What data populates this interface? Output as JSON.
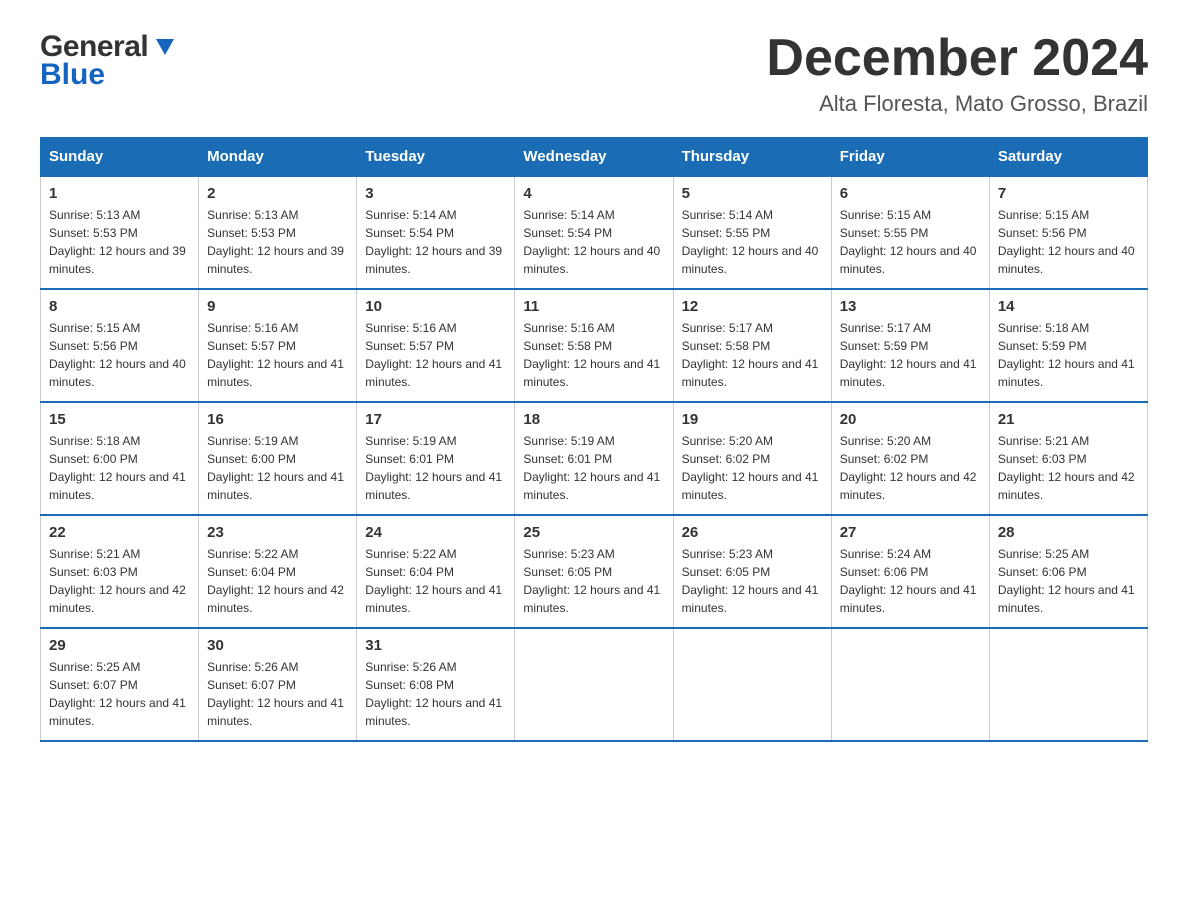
{
  "header": {
    "logo_general": "General",
    "logo_blue": "Blue",
    "title": "December 2024",
    "location": "Alta Floresta, Mato Grosso, Brazil"
  },
  "calendar": {
    "days_of_week": [
      "Sunday",
      "Monday",
      "Tuesday",
      "Wednesday",
      "Thursday",
      "Friday",
      "Saturday"
    ],
    "weeks": [
      [
        {
          "day": "1",
          "sunrise": "5:13 AM",
          "sunset": "5:53 PM",
          "daylight": "12 hours and 39 minutes."
        },
        {
          "day": "2",
          "sunrise": "5:13 AM",
          "sunset": "5:53 PM",
          "daylight": "12 hours and 39 minutes."
        },
        {
          "day": "3",
          "sunrise": "5:14 AM",
          "sunset": "5:54 PM",
          "daylight": "12 hours and 39 minutes."
        },
        {
          "day": "4",
          "sunrise": "5:14 AM",
          "sunset": "5:54 PM",
          "daylight": "12 hours and 40 minutes."
        },
        {
          "day": "5",
          "sunrise": "5:14 AM",
          "sunset": "5:55 PM",
          "daylight": "12 hours and 40 minutes."
        },
        {
          "day": "6",
          "sunrise": "5:15 AM",
          "sunset": "5:55 PM",
          "daylight": "12 hours and 40 minutes."
        },
        {
          "day": "7",
          "sunrise": "5:15 AM",
          "sunset": "5:56 PM",
          "daylight": "12 hours and 40 minutes."
        }
      ],
      [
        {
          "day": "8",
          "sunrise": "5:15 AM",
          "sunset": "5:56 PM",
          "daylight": "12 hours and 40 minutes."
        },
        {
          "day": "9",
          "sunrise": "5:16 AM",
          "sunset": "5:57 PM",
          "daylight": "12 hours and 41 minutes."
        },
        {
          "day": "10",
          "sunrise": "5:16 AM",
          "sunset": "5:57 PM",
          "daylight": "12 hours and 41 minutes."
        },
        {
          "day": "11",
          "sunrise": "5:16 AM",
          "sunset": "5:58 PM",
          "daylight": "12 hours and 41 minutes."
        },
        {
          "day": "12",
          "sunrise": "5:17 AM",
          "sunset": "5:58 PM",
          "daylight": "12 hours and 41 minutes."
        },
        {
          "day": "13",
          "sunrise": "5:17 AM",
          "sunset": "5:59 PM",
          "daylight": "12 hours and 41 minutes."
        },
        {
          "day": "14",
          "sunrise": "5:18 AM",
          "sunset": "5:59 PM",
          "daylight": "12 hours and 41 minutes."
        }
      ],
      [
        {
          "day": "15",
          "sunrise": "5:18 AM",
          "sunset": "6:00 PM",
          "daylight": "12 hours and 41 minutes."
        },
        {
          "day": "16",
          "sunrise": "5:19 AM",
          "sunset": "6:00 PM",
          "daylight": "12 hours and 41 minutes."
        },
        {
          "day": "17",
          "sunrise": "5:19 AM",
          "sunset": "6:01 PM",
          "daylight": "12 hours and 41 minutes."
        },
        {
          "day": "18",
          "sunrise": "5:19 AM",
          "sunset": "6:01 PM",
          "daylight": "12 hours and 41 minutes."
        },
        {
          "day": "19",
          "sunrise": "5:20 AM",
          "sunset": "6:02 PM",
          "daylight": "12 hours and 41 minutes."
        },
        {
          "day": "20",
          "sunrise": "5:20 AM",
          "sunset": "6:02 PM",
          "daylight": "12 hours and 42 minutes."
        },
        {
          "day": "21",
          "sunrise": "5:21 AM",
          "sunset": "6:03 PM",
          "daylight": "12 hours and 42 minutes."
        }
      ],
      [
        {
          "day": "22",
          "sunrise": "5:21 AM",
          "sunset": "6:03 PM",
          "daylight": "12 hours and 42 minutes."
        },
        {
          "day": "23",
          "sunrise": "5:22 AM",
          "sunset": "6:04 PM",
          "daylight": "12 hours and 42 minutes."
        },
        {
          "day": "24",
          "sunrise": "5:22 AM",
          "sunset": "6:04 PM",
          "daylight": "12 hours and 41 minutes."
        },
        {
          "day": "25",
          "sunrise": "5:23 AM",
          "sunset": "6:05 PM",
          "daylight": "12 hours and 41 minutes."
        },
        {
          "day": "26",
          "sunrise": "5:23 AM",
          "sunset": "6:05 PM",
          "daylight": "12 hours and 41 minutes."
        },
        {
          "day": "27",
          "sunrise": "5:24 AM",
          "sunset": "6:06 PM",
          "daylight": "12 hours and 41 minutes."
        },
        {
          "day": "28",
          "sunrise": "5:25 AM",
          "sunset": "6:06 PM",
          "daylight": "12 hours and 41 minutes."
        }
      ],
      [
        {
          "day": "29",
          "sunrise": "5:25 AM",
          "sunset": "6:07 PM",
          "daylight": "12 hours and 41 minutes."
        },
        {
          "day": "30",
          "sunrise": "5:26 AM",
          "sunset": "6:07 PM",
          "daylight": "12 hours and 41 minutes."
        },
        {
          "day": "31",
          "sunrise": "5:26 AM",
          "sunset": "6:08 PM",
          "daylight": "12 hours and 41 minutes."
        },
        null,
        null,
        null,
        null
      ]
    ],
    "sunrise_label": "Sunrise:",
    "sunset_label": "Sunset:",
    "daylight_label": "Daylight:"
  }
}
